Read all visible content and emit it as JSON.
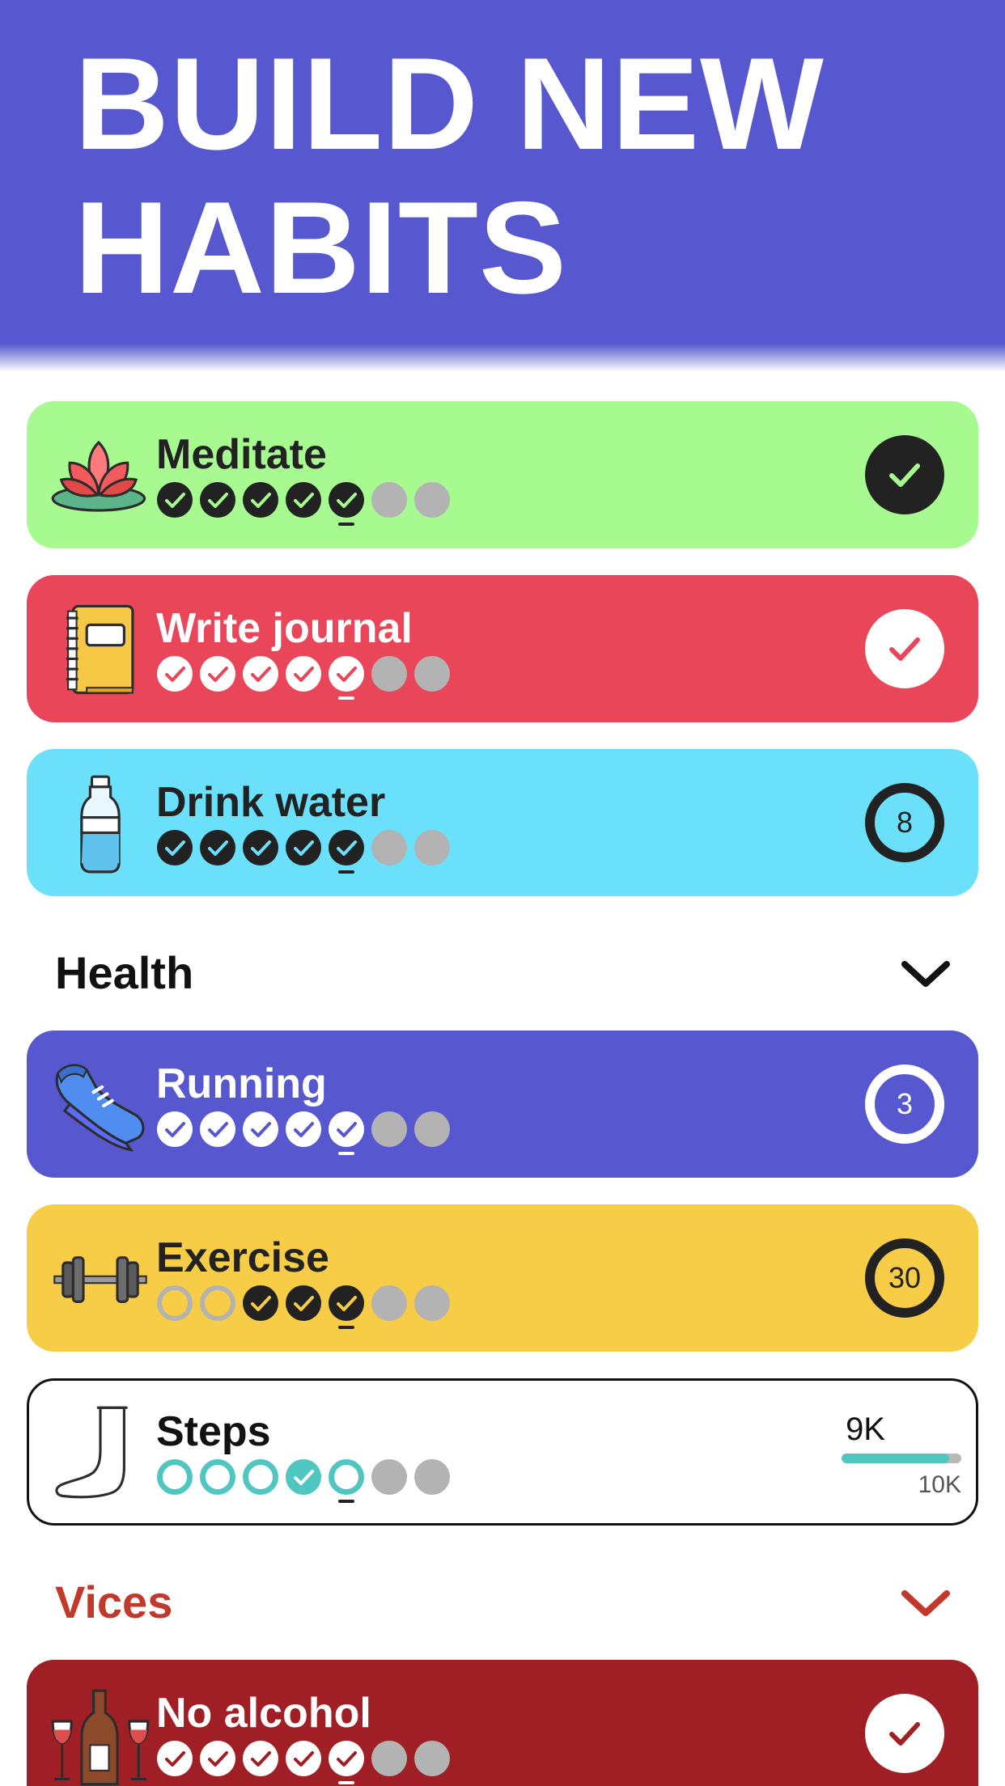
{
  "header": {
    "title_line1": "BUILD NEW",
    "title_line2": "HABITS"
  },
  "colors": {
    "accent": "#5757cf",
    "meditate": "#a6fa90",
    "journal": "#e9465a",
    "water": "#6be0fa",
    "running": "#5757cf",
    "exercise": "#f7cc46",
    "vices": "#a01f24",
    "vices_title": "#c0392b"
  },
  "habits_top": [
    {
      "name": "Meditate",
      "icon": "lotus-icon",
      "action": "check-filled"
    },
    {
      "name": "Write journal",
      "icon": "notebook-icon",
      "action": "check-white"
    },
    {
      "name": "Drink water",
      "icon": "water-bottle-icon",
      "action": "ring",
      "count": "8"
    }
  ],
  "sections": [
    {
      "title": "Health",
      "icon": "chevron-down-icon",
      "habits": [
        {
          "name": "Running",
          "icon": "sneaker-icon",
          "action": "ring",
          "count": "3"
        },
        {
          "name": "Exercise",
          "icon": "dumbbell-icon",
          "action": "ring",
          "count": "30"
        },
        {
          "name": "Steps",
          "icon": "foot-icon",
          "value": "9K",
          "goal": "10K",
          "progress": 0.9
        }
      ]
    },
    {
      "title": "Vices",
      "icon": "chevron-down-icon",
      "habits": [
        {
          "name": "No alcohol",
          "icon": "wine-icon",
          "action": "check-white"
        }
      ]
    }
  ],
  "week_dots": {
    "meditate": [
      "done",
      "done",
      "done",
      "done",
      "done-today",
      "empty",
      "empty"
    ],
    "journal": [
      "done",
      "done",
      "done",
      "done",
      "done-today",
      "empty",
      "empty"
    ],
    "water": [
      "done",
      "done",
      "done",
      "done",
      "done-today",
      "empty",
      "empty"
    ],
    "running": [
      "done",
      "done",
      "done",
      "done",
      "done-today",
      "empty",
      "empty"
    ],
    "exercise": [
      "missed",
      "missed",
      "done",
      "done",
      "done-today",
      "empty",
      "empty"
    ],
    "steps": [
      "partial",
      "partial",
      "partial",
      "done",
      "partial-today",
      "empty",
      "empty"
    ],
    "no_alcohol": [
      "done",
      "done",
      "done",
      "done",
      "done-today",
      "empty",
      "empty"
    ]
  }
}
